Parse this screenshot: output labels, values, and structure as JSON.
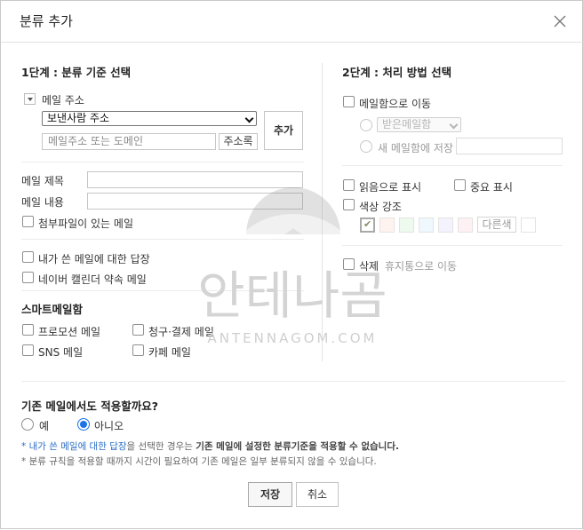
{
  "dialog": {
    "title": "분류 추가"
  },
  "step1": {
    "heading": "1단계 : 분류 기준 선택",
    "address_label": "메일 주소",
    "sender_select": "보낸사람 주소",
    "address_placeholder": "메일주소 또는 도메인",
    "addressbook_button": "주소록",
    "add_button": "추가",
    "subject_label": "메일 제목",
    "subject_value": "",
    "body_label": "메일 내용",
    "body_value": "",
    "attachment_label": "첨부파일이 있는 메일",
    "reply_label": "내가 쓴 메일에 대한 답장",
    "calendar_label": "네이버 캘린더 약속 메일",
    "smartmail_heading": "스마트메일함",
    "promo_label": "프로모션 메일",
    "billing_label": "청구·결제 메일",
    "sns_label": "SNS 메일",
    "cafe_label": "카페 메일"
  },
  "step2": {
    "heading": "2단계 : 처리 방법 선택",
    "move_label": "메일함으로 이동",
    "mailbox_select": "받은메일함",
    "new_mailbox_label": "새 메일함에 저장",
    "new_mailbox_value": "",
    "mark_read_label": "읽음으로 표시",
    "important_label": "중요 표시",
    "color_label": "색상 강조",
    "other_color_button": "다른색",
    "swatch_colors": [
      "#ffffff",
      "#fff3ef",
      "#eefaee",
      "#eef8fd",
      "#f4f2fd",
      "#fdf1f4"
    ],
    "delete_label": "삭제",
    "delete_sub": "휴지통으로 이동"
  },
  "apply_existing": {
    "question": "기존 메일에서도 적용할까요?",
    "yes_label": "예",
    "no_label": "아니오",
    "selected": "아니오"
  },
  "notes": {
    "line1_prefix": "* 내가 쓴 메일에 대한 답장",
    "line1_mid": "을 선택한 경우는 ",
    "line1_bold": "기존 메일에 설정한 분류기준을 적용할 수 없습니다.",
    "line2": "* 분류 규칙을 적용할 때까지 시간이 필요하여 기존 메일은 일부 분류되지 않을 수 있습니다."
  },
  "footer": {
    "save_button": "저장",
    "cancel_button": "취소"
  },
  "watermark": {
    "korean": "안테나곰",
    "latin": "ANTENNAGOM.COM"
  },
  "colors": {
    "accent": "#1a73e8",
    "note_blue": "#2a6dc6",
    "border": "#c4c4c4"
  }
}
